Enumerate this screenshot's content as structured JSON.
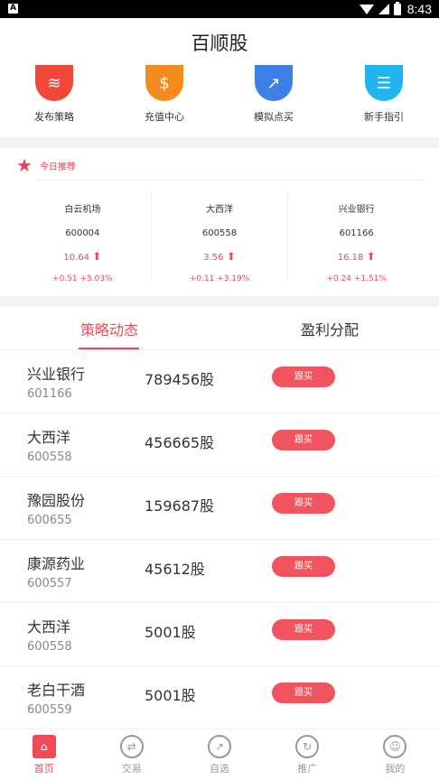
{
  "status_bar": {
    "time": "8:43",
    "left_icon": "A"
  },
  "app": {
    "title": "百顺股"
  },
  "quick_actions": [
    {
      "label": "发布策略",
      "icon": "layers-icon",
      "color": "#f0473b"
    },
    {
      "label": "充值中心",
      "icon": "money-bag-icon",
      "color": "#f58a1f"
    },
    {
      "label": "模拟点买",
      "icon": "trend-chart-icon",
      "color": "#3d80e6"
    },
    {
      "label": "新手指引",
      "icon": "clipboard-icon",
      "color": "#22b4ef"
    }
  ],
  "recommend": {
    "title": "今日推荐",
    "items": [
      {
        "name": "白云机场",
        "code": "600004",
        "price": "10.64",
        "change": "+0.51 +5.03%"
      },
      {
        "name": "大西洋",
        "code": "600558",
        "price": "3.56",
        "change": "+0.11 +3.19%"
      },
      {
        "name": "兴业银行",
        "code": "601166",
        "price": "16.18",
        "change": "+0.24 +1.51%"
      }
    ]
  },
  "tabs": [
    {
      "label": "策略动态",
      "active": true
    },
    {
      "label": "盈利分配",
      "active": false
    }
  ],
  "strategy_list": [
    {
      "name": "兴业银行",
      "code": "601166",
      "quantity": "789456股",
      "button": "跟买"
    },
    {
      "name": "大西洋",
      "code": "600558",
      "quantity": "456665股",
      "button": "跟买"
    },
    {
      "name": "豫园股份",
      "code": "600655",
      "quantity": "159687股",
      "button": "跟买"
    },
    {
      "name": "康源药业",
      "code": "600557",
      "quantity": "45612股",
      "button": "跟买"
    },
    {
      "name": "大西洋",
      "code": "600558",
      "quantity": "5001股",
      "button": "跟买"
    },
    {
      "name": "老白干酒",
      "code": "600559",
      "quantity": "5001股",
      "button": "跟买"
    }
  ],
  "bottom_nav": [
    {
      "label": "首页",
      "icon": "home-icon",
      "active": true
    },
    {
      "label": "交易",
      "icon": "exchange-icon",
      "active": false
    },
    {
      "label": "自选",
      "icon": "trend-icon",
      "active": false
    },
    {
      "label": "推广",
      "icon": "refresh-icon",
      "active": false
    },
    {
      "label": "我的",
      "icon": "user-icon",
      "active": false
    }
  ],
  "colors": {
    "accent": "#ef4a55",
    "divider": "#f2f2f2"
  }
}
